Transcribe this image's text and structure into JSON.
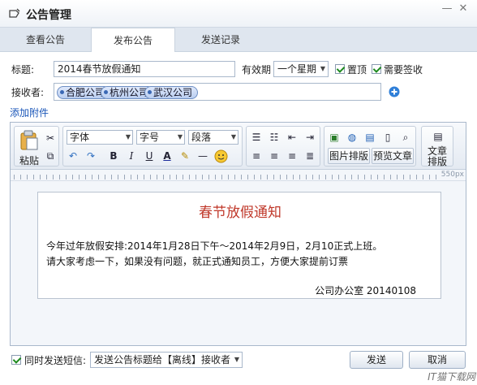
{
  "window": {
    "title": "公告管理",
    "min_symbol": "—",
    "close_symbol": "✕"
  },
  "tabs": [
    {
      "label": "查看公告"
    },
    {
      "label": "发布公告"
    },
    {
      "label": "发送记录"
    }
  ],
  "form": {
    "title_label": "标题:",
    "title_value": "2014春节放假通知",
    "validity_label": "有效期",
    "validity_value": "一个星期",
    "pin_label": "置顶",
    "signin_label": "需要签收",
    "recipients_label": "接收者:",
    "recipients": [
      "合肥公司",
      "杭州公司",
      "武汉公司"
    ],
    "attach_link": "添加附件"
  },
  "toolbar": {
    "paste_label": "粘贴",
    "font_value": "字体",
    "size_value": "字号",
    "para_value": "段落",
    "bold": "B",
    "italic": "I",
    "underline": "U",
    "fontcolor": "A",
    "hr": "—",
    "image_layout": "图片排版",
    "preview": "预览文章",
    "article_layout_1": "文章",
    "article_layout_2": "排版"
  },
  "ruler": {
    "label": "550px"
  },
  "document": {
    "title": "春节放假通知",
    "line1": "今年过年放假安排:2014年1月28日下午～2014年2月9日，2月10正式上班。",
    "line2": "请大家考虑一下，如果没有问题，就正式通知员工，方便大家提前订票",
    "signature": "公司办公室 20140108"
  },
  "footer": {
    "sms_label": "同时发送短信:",
    "sms_template": "发送公告标题给【离线】接收者",
    "send": "发送",
    "cancel": "取消"
  },
  "watermark": "IT猫下载网",
  "colors": {
    "accent": "#1a56b8",
    "doc_title": "#c0392b",
    "chip_bg": "#b9cdf0"
  }
}
